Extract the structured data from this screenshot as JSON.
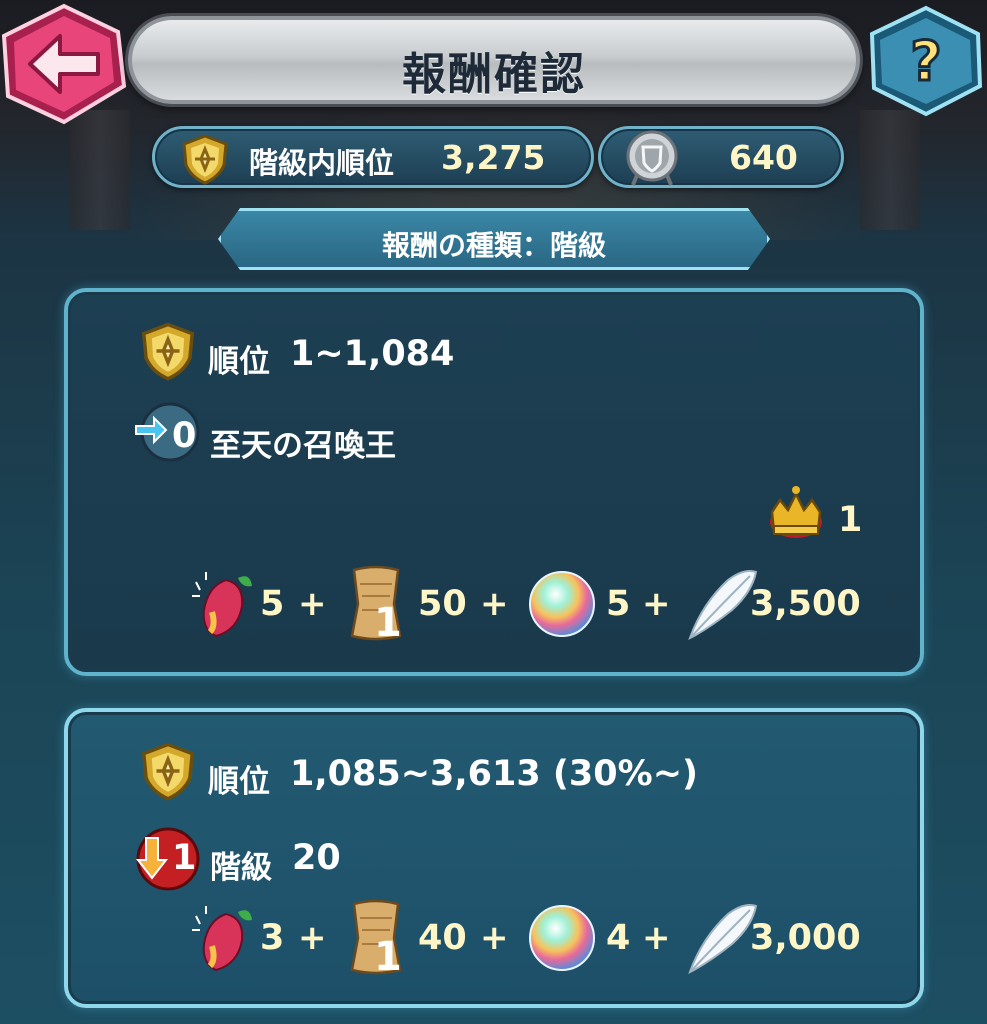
{
  "header": {
    "title": "報酬確認",
    "back_icon": "back-arrow-icon",
    "help_label": "?"
  },
  "stats": {
    "rank_label": "階級内順位",
    "rank_value": "3,275",
    "points_value": "640"
  },
  "reward_type": "報酬の種類：階級",
  "tiers": [
    {
      "rank_label": "順位",
      "rank_range": "1~1,084",
      "status_badge": "0",
      "status_text": "至天の召喚王",
      "crown_count": "1",
      "rewards": [
        {
          "icon": "sacred-fruit-icon",
          "amount": "5"
        },
        {
          "icon": "scroll-icon",
          "badge": "1",
          "amount": "50"
        },
        {
          "icon": "orb-icon",
          "amount": "5"
        },
        {
          "icon": "feather-icon",
          "amount": "3,500"
        }
      ]
    },
    {
      "rank_label": "順位",
      "rank_range": "1,085~3,613 (30%~)",
      "status_badge": "1",
      "status_label": "階級",
      "status_value": "20",
      "rewards": [
        {
          "icon": "sacred-fruit-icon",
          "amount": "3"
        },
        {
          "icon": "scroll-icon",
          "badge": "1",
          "amount": "40"
        },
        {
          "icon": "orb-icon",
          "amount": "4"
        },
        {
          "icon": "feather-icon",
          "amount": "3,000"
        }
      ]
    }
  ],
  "plus_sign": "+",
  "colors": {
    "accent": "#fff6c8",
    "frame": "#6fb2c9",
    "back_button": "#e8457a",
    "help_button": "#3b8fb2"
  }
}
